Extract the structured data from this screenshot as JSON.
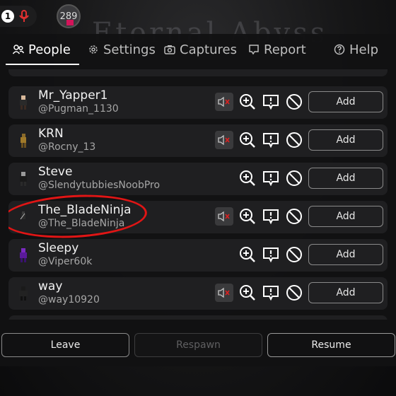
{
  "game": {
    "title": "Eternal Abyss"
  },
  "hud": {
    "notification_count": "1",
    "player_count": "289"
  },
  "tabs": [
    {
      "label": "People",
      "icon": "people-icon",
      "active": true
    },
    {
      "label": "Settings",
      "icon": "gear-icon",
      "active": false
    },
    {
      "label": "Captures",
      "icon": "camera-icon",
      "active": false
    },
    {
      "label": "Report",
      "icon": "report-flag-icon",
      "active": false
    },
    {
      "label": "Help",
      "icon": "help-icon",
      "active": false
    }
  ],
  "players": [
    {
      "name": "Mr_Yapper1",
      "handle": "@Pugman_1130",
      "muted": true,
      "add_label": "Add"
    },
    {
      "name": "KRN",
      "handle": "@Rocny_13",
      "muted": true,
      "add_label": "Add"
    },
    {
      "name": "Steve",
      "handle": "@SlendytubbiesNoobPro",
      "muted": false,
      "add_label": "Add"
    },
    {
      "name": "The_BladeNinja",
      "handle": "@The_BladeNinja",
      "muted": true,
      "add_label": "Add",
      "highlighted": true
    },
    {
      "name": "Sleepy",
      "handle": "@Viper60k",
      "muted": false,
      "add_label": "Add"
    },
    {
      "name": "way",
      "handle": "@way10920",
      "muted": true,
      "add_label": "Add"
    }
  ],
  "bottom": {
    "leave": "Leave",
    "respawn": "Respawn",
    "resume": "Resume"
  },
  "colors": {
    "highlight_ring": "#e01515",
    "mute_x": "#e02020",
    "panel_bg": "#1f1f21"
  }
}
